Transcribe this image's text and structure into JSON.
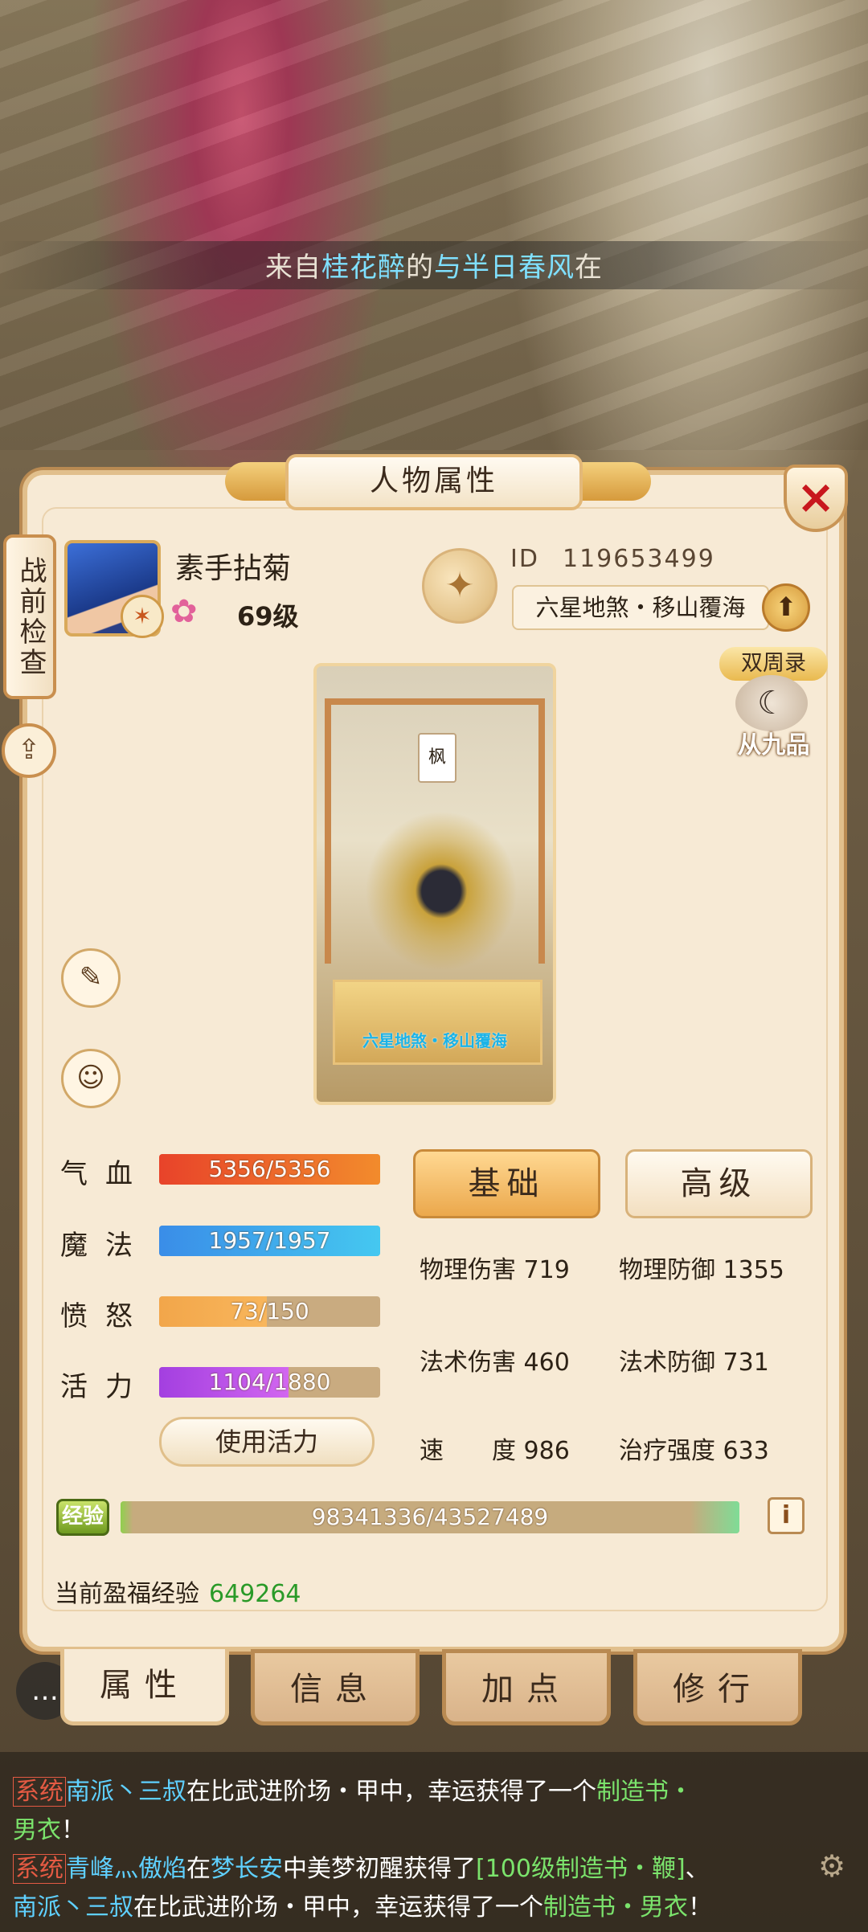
{
  "banner": {
    "prefix": "来自",
    "name1": "桂花醉",
    "middle": "的",
    "name2": "与半日春风",
    "suffix": "在"
  },
  "panel": {
    "title": "人物属性",
    "close_icon": "×"
  },
  "side": {
    "pre_battle": "战前检查",
    "share_icon": "⇪"
  },
  "profile": {
    "name": "素手拈菊",
    "level": "69级",
    "id_label": "ID",
    "id_value": "119653499",
    "title": "六星地煞・移山覆海",
    "up_icon": "⬆",
    "dual_tag": "双周录",
    "dual_rank": "从九品",
    "dual_icon": "☾",
    "coin_icon": "✦",
    "badge_icon": "✶",
    "lotus_icon": "✿"
  },
  "stage": {
    "flag": "枫",
    "caption": "六星地煞・移山覆海"
  },
  "left_icons": {
    "edit": "✎",
    "friend": "☺"
  },
  "stats": [
    {
      "label": "气血",
      "value": "5356/5356",
      "fraction": 1.0,
      "color_from": "#e8432a",
      "color_to": "#f28b2c"
    },
    {
      "label": "魔法",
      "value": "1957/1957",
      "fraction": 1.0,
      "color_from": "#3a8de8",
      "color_to": "#45c8f0"
    },
    {
      "label": "愤怒",
      "value": "73/150",
      "fraction": 0.487,
      "color_from": "#f2a64a",
      "color_to": "#f8b65c"
    },
    {
      "label": "活力",
      "value": "1104/1880",
      "fraction": 0.587,
      "color_from": "#a33fe0",
      "color_to": "#d266f0"
    }
  ],
  "use_vitality": "使用活力",
  "attr_tabs": {
    "basic": "基础",
    "advanced": "高级"
  },
  "attributes": [
    {
      "label": "物理伤害",
      "value": "719"
    },
    {
      "label": "物理防御",
      "value": "1355"
    },
    {
      "label": "法术伤害",
      "value": "460"
    },
    {
      "label": "法术防御",
      "value": "731"
    },
    {
      "label": "速　　度",
      "value": "986"
    },
    {
      "label": "治疗强度",
      "value": "633"
    }
  ],
  "exp": {
    "badge": "经验",
    "value": "98341336/43527489",
    "info": "i",
    "bonus_label": "当前盈福经验",
    "bonus_value": "649264"
  },
  "bottom_tabs": [
    "属性",
    "信息",
    "加点",
    "修行"
  ],
  "chat_icon": "…",
  "chat": {
    "line1": {
      "tag": "系统",
      "name": "南派丶三叔",
      "t1": "在比武进阶场・甲中，幸运获得了一个",
      "item": "制造书・"
    },
    "line2": {
      "item": "男衣",
      "t1": "！"
    },
    "line3": {
      "tag": "系统",
      "name": "青峰灬傲焰",
      "t1": "在",
      "place": "梦长安",
      "t2": "中美梦初醒获得了",
      "item": "[100级制造书・鞭]",
      "t3": "、"
    },
    "line4": {
      "name": "南派丶三叔",
      "t1": "在比武进阶场・甲中，幸运获得了一个",
      "item": "制造书・男衣",
      "t2": "！"
    },
    "gear_icon": "⚙"
  }
}
